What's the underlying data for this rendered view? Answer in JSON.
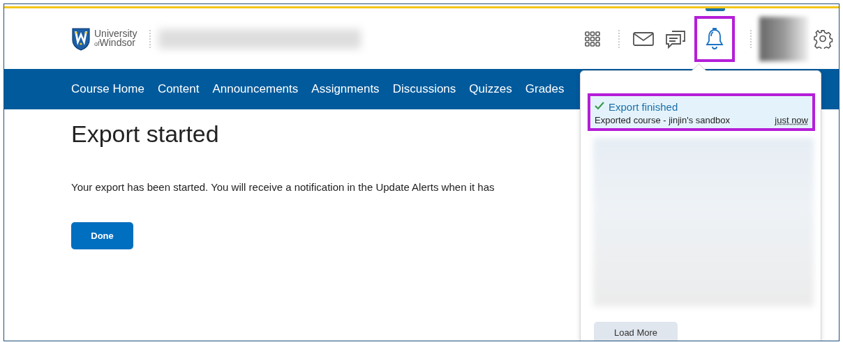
{
  "header": {
    "logo": {
      "line1": "University",
      "line2_small": "of",
      "line2": "Windsor"
    },
    "alerts": {
      "selected": true,
      "highlighted": true
    }
  },
  "nav": {
    "items": [
      "Course Home",
      "Content",
      "Announcements",
      "Assignments",
      "Discussions",
      "Quizzes",
      "Grades"
    ]
  },
  "page": {
    "title": "Export started",
    "message": "Your export has been started. You will receive a notification in the Update Alerts when it has",
    "button": "Done"
  },
  "alerts_panel": {
    "items": [
      {
        "title": "Export finished",
        "detail": "Exported course - jinjin's sandbox",
        "time": "just now",
        "highlighted": true
      }
    ],
    "load_more": "Load More"
  }
}
